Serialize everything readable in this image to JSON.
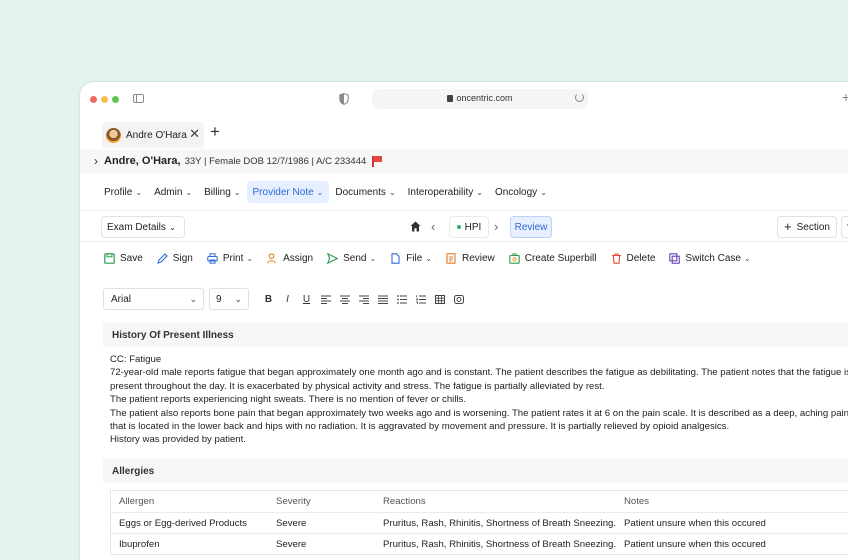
{
  "browser": {
    "url": "oncentric.com"
  },
  "tab": {
    "label": "Andre O'Hara"
  },
  "patient": {
    "name": "Andre, O'Hara,",
    "info": "33Y | Female DOB 12/7/1986 | A/C 233444"
  },
  "menu": {
    "items": [
      {
        "label": "Profile"
      },
      {
        "label": "Admin"
      },
      {
        "label": "Billing"
      },
      {
        "label": "Provider Note"
      },
      {
        "label": "Documents"
      },
      {
        "label": "Interoperability"
      },
      {
        "label": "Oncology"
      }
    ]
  },
  "nav": {
    "exam_select": "Exam Details",
    "hpi_label": "HPI",
    "review_label": "Review",
    "section_label": "Section"
  },
  "actions": {
    "save": "Save",
    "sign": "Sign",
    "print": "Print",
    "assign": "Assign",
    "send": "Send",
    "file": "File",
    "review": "Review",
    "create_superbill": "Create Superbill",
    "delete": "Delete",
    "switch_case": "Switch Case"
  },
  "editor": {
    "font": "Arial",
    "size": "9",
    "bold": "B",
    "italic": "I",
    "underline": "U"
  },
  "hpi": {
    "title": "History Of Present Illness",
    "lines": [
      "CC: Fatigue",
      "72-year-old male reports fatigue that began approximately one month ago and is constant. The patient describes the fatigue as debilitating. The patient notes that the fatigue is present throughout the day. It is exacerbated by physical activity and stress. The fatigue is partially alleviated by rest.",
      "The patient reports experiencing night sweats. There is no mention of fever or chills.",
      "The patient also reports bone pain that began approximately two weeks ago and is worsening. The patient rates it at 6 on the pain scale. It is described as a deep, aching pain that is located in the lower back and hips with no radiation. It is aggravated by movement and pressure. It is partially relieved by opioid analgesics.",
      "History was provided by patient."
    ]
  },
  "allergies": {
    "title": "Allergies",
    "columns": [
      "Allergen",
      "Severity",
      "Reactions",
      "Notes"
    ],
    "rows": [
      [
        "Eggs or Egg-derived Products",
        "Severe",
        "Pruritus, Rash, Rhinitis, Shortness of Breath Sneezing.",
        "Patient unsure when this occured"
      ],
      [
        "Ibuprofen",
        "Severe",
        "Pruritus, Rash, Rhinitis, Shortness of Breath Sneezing.",
        "Patient unsure when this occured"
      ]
    ]
  },
  "colors": {
    "background": "#e3f3ee",
    "accent": "#2f6bd6",
    "active_menu_bg": "#e5efff",
    "hpi_dot": "#2fae6a",
    "flag": "#e34848"
  }
}
